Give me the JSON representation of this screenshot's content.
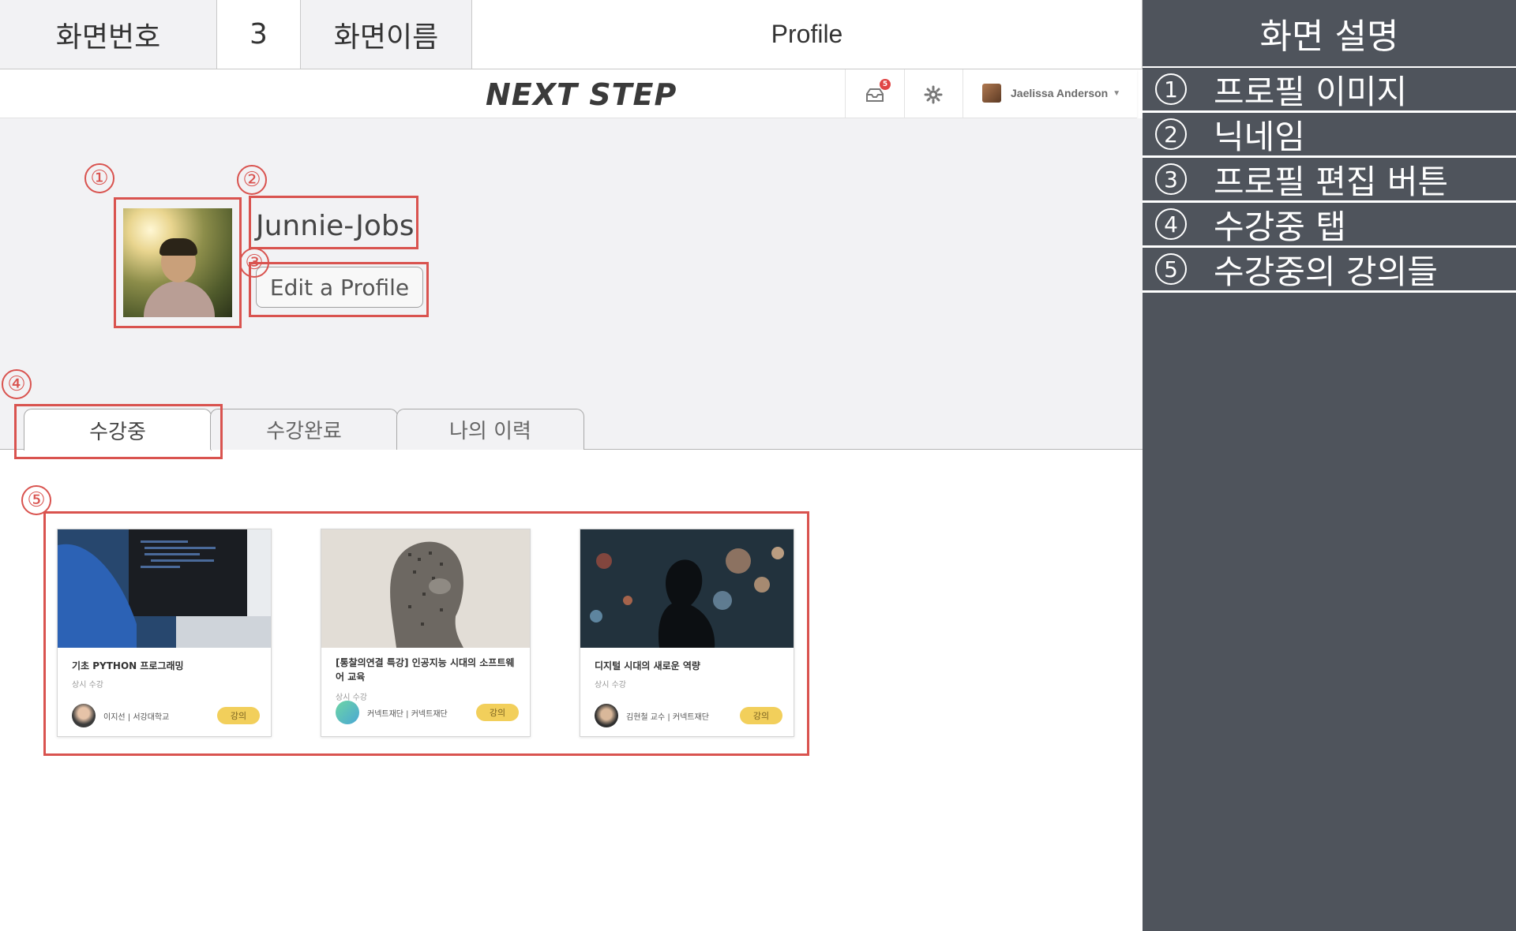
{
  "spec": {
    "screen_no_label": "화면번호",
    "screen_no": "3",
    "screen_name_label": "화면이름",
    "screen_name": "Profile"
  },
  "description": {
    "title": "화면 설명",
    "items": [
      {
        "num": "1",
        "text": "프로필 이미지"
      },
      {
        "num": "2",
        "text": "닉네임"
      },
      {
        "num": "3",
        "text": "프로필 편집 버튼"
      },
      {
        "num": "4",
        "text": "수강중 탭"
      },
      {
        "num": "5",
        "text": "수강중의 강의들"
      }
    ]
  },
  "navbar": {
    "logo": "NEXT STEP",
    "notification_count": "5",
    "user_name": "Jaelissa Anderson"
  },
  "profile": {
    "nickname": "Junnie-Jobs",
    "edit_label": "Edit a Profile"
  },
  "tabs": [
    {
      "label": "수강중",
      "active": true
    },
    {
      "label": "수강완료",
      "active": false
    },
    {
      "label": "나의 이력",
      "active": false
    }
  ],
  "courses": [
    {
      "title": "기초 PYTHON 프로그래밍",
      "subtitle": "상시 수강",
      "instructor": "이지선 | 서강대학교",
      "tag": "강의"
    },
    {
      "title": "[통찰의연결 특강] 인공지능 시대의 소프트웨어 교육",
      "subtitle": "상시 수강",
      "instructor": "커넥트재단 | 커넥트재단",
      "tag": "강의"
    },
    {
      "title": "디지털 시대의 새로운 역량",
      "subtitle": "상시 수강",
      "instructor": "김현철 교수 | 커넥트재단",
      "tag": "강의"
    }
  ],
  "markers": [
    "①",
    "②",
    "③",
    "④",
    "⑤"
  ],
  "colors": {
    "annotation": "#d9534f",
    "panel": "#4f545c",
    "tag": "#f2cf5b",
    "app_bg": "#f2f2f4"
  }
}
